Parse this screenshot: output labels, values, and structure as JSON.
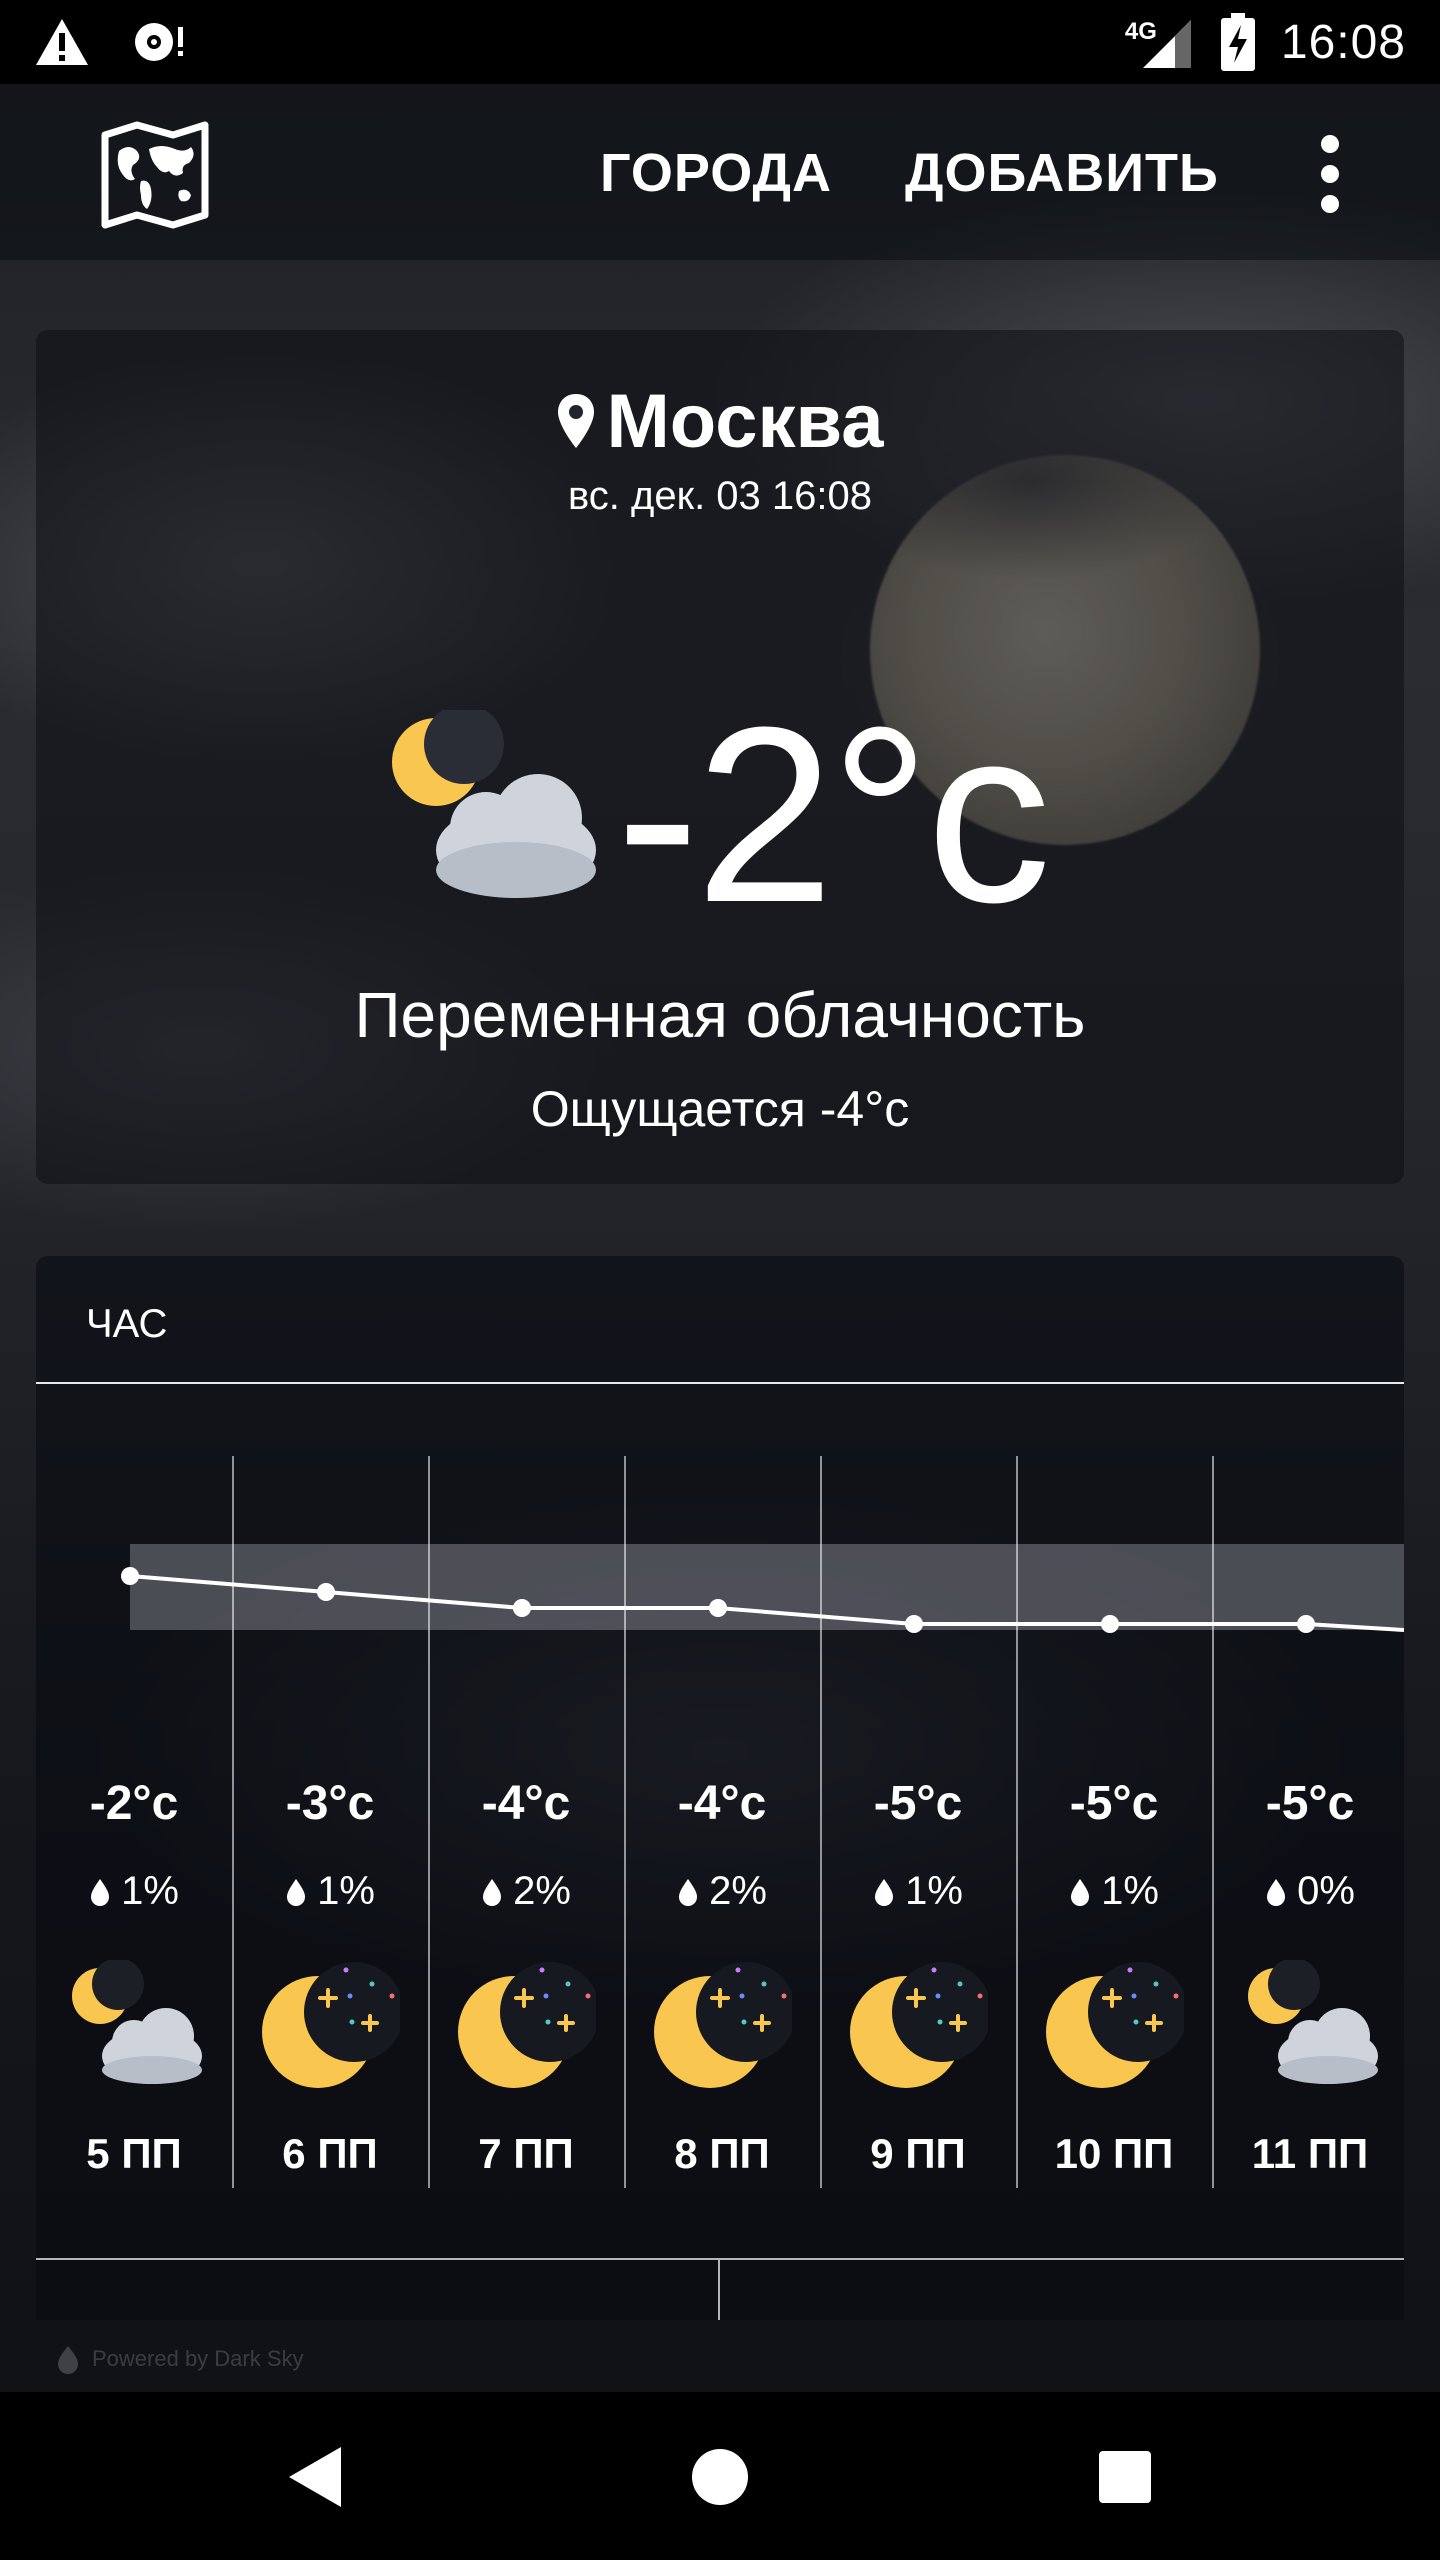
{
  "status_bar": {
    "time": "16:08",
    "network": "4G",
    "icons": [
      "warning-icon",
      "sync-notification-icon",
      "signal-icon",
      "battery-charging-icon"
    ]
  },
  "app_bar": {
    "map_icon": "world-map-icon",
    "cities_label": "ГОРОДА",
    "add_label": "ДОБАВИТЬ",
    "menu_icon": "more-vert-icon"
  },
  "current": {
    "location_icon": "location-pin-icon",
    "city": "Москва",
    "date": "вс. дек. 03 16:08",
    "icon": "partly-cloudy-night-icon",
    "temperature": "-2°c",
    "condition": "Переменная облачность",
    "feels_like": "Ощущается -4°c"
  },
  "hourly": {
    "title": "ЧАС",
    "hours": [
      {
        "temp": "-2°c",
        "precip": "1%",
        "icon": "partly-cloudy-night-icon",
        "label": "5 ПП"
      },
      {
        "temp": "-3°c",
        "precip": "1%",
        "icon": "clear-night-icon",
        "label": "6 ПП"
      },
      {
        "temp": "-4°c",
        "precip": "2%",
        "icon": "clear-night-icon",
        "label": "7 ПП"
      },
      {
        "temp": "-4°c",
        "precip": "2%",
        "icon": "clear-night-icon",
        "label": "8 ПП"
      },
      {
        "temp": "-5°c",
        "precip": "1%",
        "icon": "clear-night-icon",
        "label": "9 ПП"
      },
      {
        "temp": "-5°c",
        "precip": "1%",
        "icon": "clear-night-icon",
        "label": "10 ПП"
      },
      {
        "temp": "-5°c",
        "precip": "0%",
        "icon": "partly-cloudy-night-icon",
        "label": "11 ПП"
      }
    ]
  },
  "chart_data": {
    "type": "line",
    "x": [
      "5 ПП",
      "6 ПП",
      "7 ПП",
      "8 ПП",
      "9 ПП",
      "10 ПП",
      "11 ПП"
    ],
    "values": [
      -2,
      -3,
      -4,
      -4,
      -5,
      -5,
      -5
    ],
    "title": "",
    "xlabel": "",
    "ylabel": ""
  },
  "footer": {
    "powered_by": "Powered by Dark Sky"
  },
  "nav_bar": {
    "back_icon": "back-triangle-icon",
    "home_icon": "home-circle-icon",
    "recents_icon": "recents-square-icon"
  },
  "colors": {
    "moon": "#f9c74f",
    "cloud": "#cfd4dc",
    "star_orange": "#f9c74f",
    "star_blue": "#6b8cff",
    "star_red": "#ff6b6b",
    "star_green": "#4ecdc4",
    "star_purple": "#c77dff"
  }
}
